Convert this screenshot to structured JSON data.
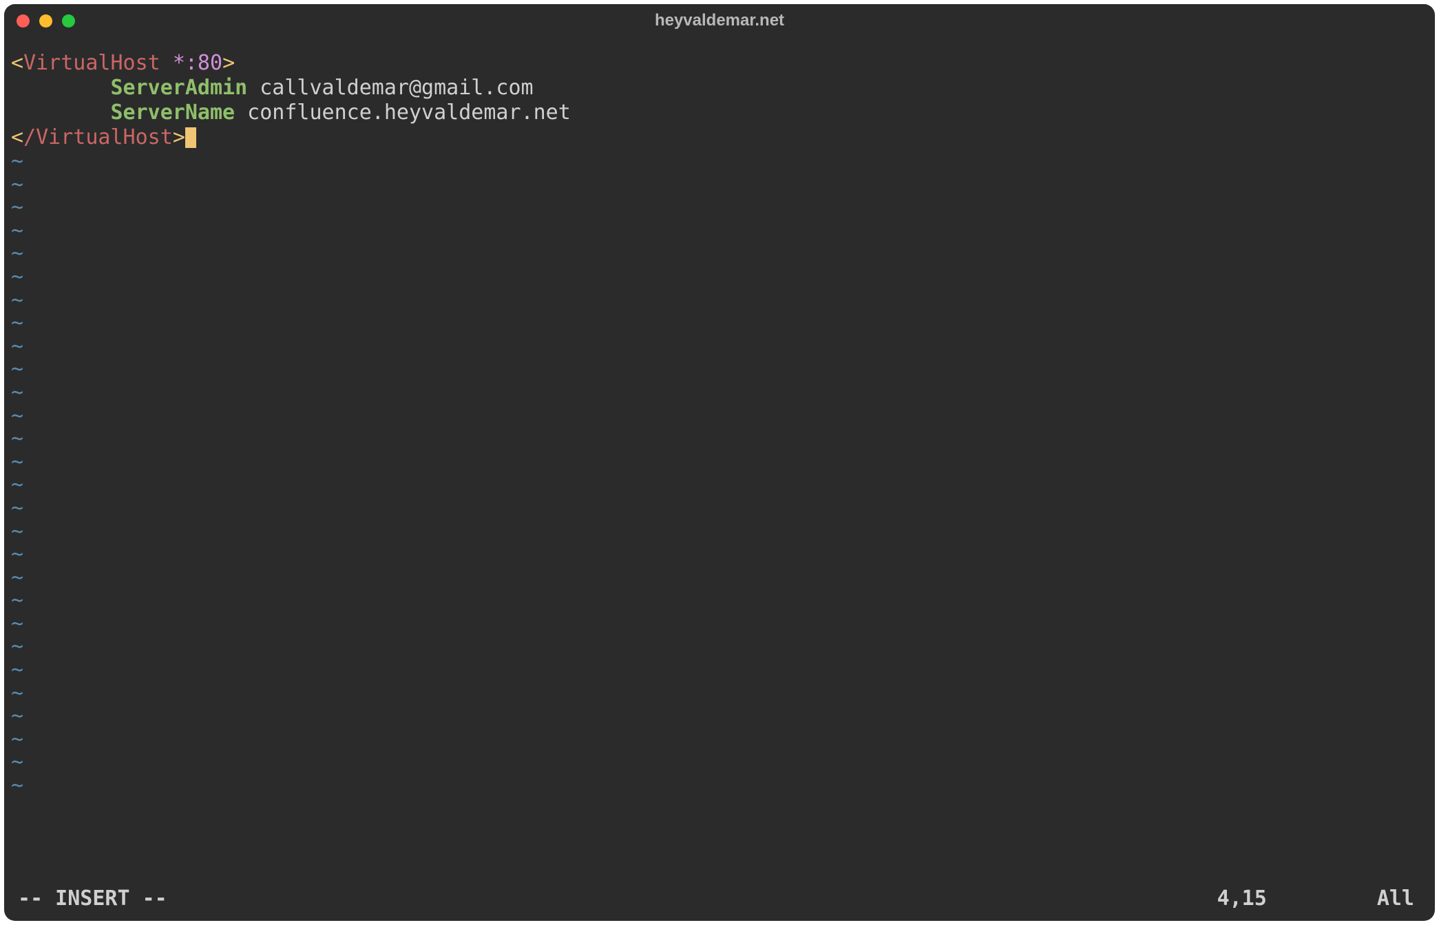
{
  "window": {
    "title": "heyvaldemar.net"
  },
  "editor": {
    "lines": [
      {
        "segments": [
          {
            "text": "<",
            "cls": "tag-bracket"
          },
          {
            "text": "VirtualHost",
            "cls": "tag-name"
          },
          {
            "text": " ",
            "cls": "value"
          },
          {
            "text": "*:80",
            "cls": "tag-attr"
          },
          {
            "text": ">",
            "cls": "tag-bracket"
          }
        ]
      },
      {
        "segments": [
          {
            "text": "        ",
            "cls": "value"
          },
          {
            "text": "ServerAdmin",
            "cls": "directive"
          },
          {
            "text": " callvaldemar@gmail.com",
            "cls": "value"
          }
        ]
      },
      {
        "segments": [
          {
            "text": "        ",
            "cls": "value"
          },
          {
            "text": "ServerName",
            "cls": "directive"
          },
          {
            "text": " confluence.heyvaldemar.net",
            "cls": "value"
          }
        ]
      },
      {
        "segments": [
          {
            "text": "<",
            "cls": "tag-bracket"
          },
          {
            "text": "/VirtualHost",
            "cls": "tag-name"
          },
          {
            "text": ">",
            "cls": "tag-bracket"
          }
        ],
        "cursor": true
      }
    ],
    "tilde": "~",
    "tilde_count": 28
  },
  "status": {
    "mode": "-- INSERT --",
    "position": "4,15",
    "scroll": "All"
  }
}
